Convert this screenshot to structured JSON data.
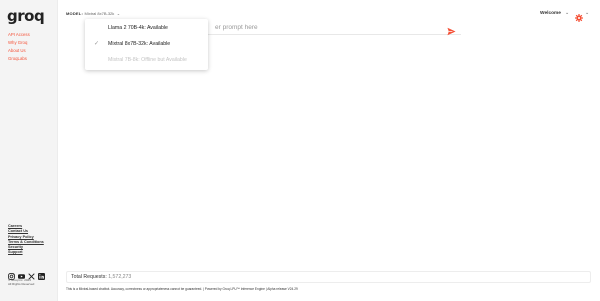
{
  "sidebar": {
    "logo": "groq",
    "links": [
      "API Access",
      "Why Groq",
      "About Us",
      "GroqLabs"
    ],
    "footer_links": [
      "Careers",
      "Contact Us",
      "Privacy Policy",
      "Terms & Conditions",
      "Security",
      "Support"
    ],
    "social_icons": [
      "instagram-icon",
      "youtube-icon",
      "x-icon",
      "linkedin-icon"
    ],
    "copyright_line1": "© Groq Inc. 2024",
    "copyright_line2": "All Rights Reserved"
  },
  "header": {
    "model_label": "MODEL:",
    "model_value": "Mixtral 8x7B-32k",
    "welcome": "Welcome"
  },
  "prompt": {
    "placeholder": "er prompt here"
  },
  "dropdown": {
    "items": [
      {
        "label": "Llama 2 70B-4k:",
        "status": "Available",
        "selected": false,
        "disabled": false
      },
      {
        "label": "Mixtral 8x7B-32k:",
        "status": "Available",
        "selected": true,
        "disabled": false
      },
      {
        "label": "Mistral 7B-8k:",
        "status": "Offline but Available",
        "selected": false,
        "disabled": true
      }
    ],
    "check_glyph": "✓"
  },
  "footer": {
    "requests_label": "Total Requests:",
    "requests_count": "1,572,273",
    "disclaimer": "This is a Mixtral-based chatbot. Accuracy, correctness or appropriateness cannot be guaranteed. | Powered by Groq LPU™ Inference Engine | Alpha release V24.29"
  },
  "colors": {
    "accent": "#f55036",
    "sidebar_bg": "#f4f4f4"
  }
}
